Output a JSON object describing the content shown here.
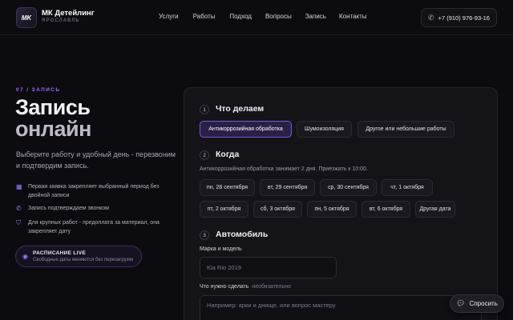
{
  "brand": {
    "logo_text": "MK",
    "name": "МК Детейлинг",
    "city": "ЯРОСЛАВЛЬ"
  },
  "nav": [
    "Услуги",
    "Работы",
    "Подход",
    "Вопросы",
    "Запись",
    "Контакты"
  ],
  "phone": {
    "icon": "phone-icon",
    "label": "+7 (910) 976-93-16"
  },
  "hero": {
    "tag": "07 / ЗАПИСЬ",
    "title_line1": "Запись",
    "title_line2": "онлайн",
    "subtitle": "Выберите работу и удобный день - перезвоним и подтвердим запись.",
    "features": [
      {
        "icon": "calendar-icon",
        "text": "Первая заявка закрепляет выбранный период без двойной записи"
      },
      {
        "icon": "phone-icon",
        "text": "Запись подтверждаем звонком"
      },
      {
        "icon": "shield-check-icon",
        "text": "Для крупных работ - предоплата за материал, она закрепляет дату"
      }
    ],
    "live": {
      "icon": "live-signal-icon",
      "title": "РАСПИСАНИЕ LIVE",
      "text": "Свободные даты меняются без перезагрузки"
    }
  },
  "form": {
    "step1": {
      "num": "1",
      "title": "Что делаем",
      "services": [
        "Антикоррозийная обработка",
        "Шумоизоляция",
        "Другое или небольшие работы"
      ],
      "selected": "Антикоррозийная обработка"
    },
    "step2": {
      "num": "2",
      "title": "Когда",
      "note": "Антикоррозийная обработка занимает 2 дня. Приезжать к 10:00.",
      "dates_row1": [
        "пн, 28 сентября",
        "вт, 29 сентября",
        "ср, 30 сентября",
        "чт, 1 октября"
      ],
      "dates_row2": [
        "пт, 2 октября",
        "сб, 3 октября",
        "пн, 5 октября",
        "вт, 6 октября",
        "Другая дата"
      ]
    },
    "step3": {
      "num": "3",
      "title": "Автомобиль",
      "car_label": "Марка и модель",
      "car_placeholder": "Kia Rio 2019",
      "task_label": "Что нужно сделать",
      "task_optional": "необязательно",
      "task_placeholder": "Например: арки и днище, или вопрос мастеру"
    }
  },
  "ask_button": {
    "icon": "chat-bubble-icon",
    "label": "Спросить"
  },
  "colors": {
    "accent": "#9b7cff",
    "background": "#0c0b0f",
    "panel": "#141318"
  }
}
